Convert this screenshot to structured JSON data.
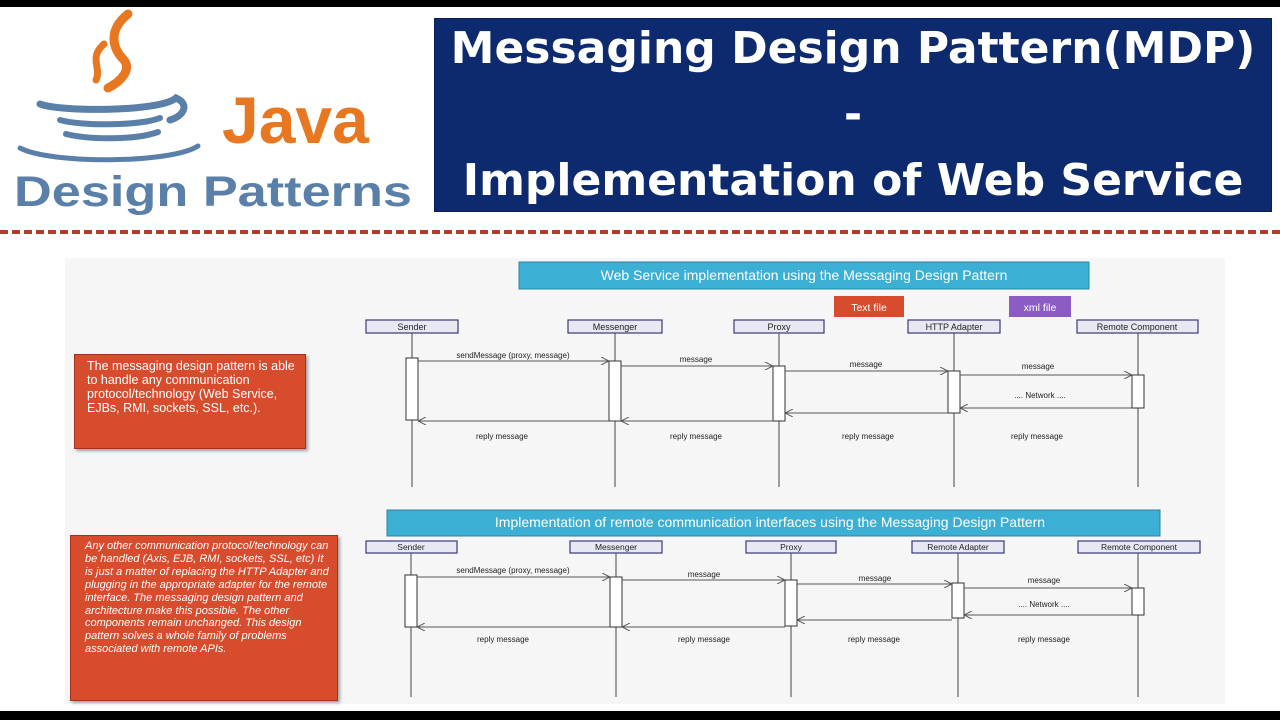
{
  "logo": {
    "java": "Java",
    "design_patterns": "Design Patterns"
  },
  "title": {
    "line1": "Messaging Design Pattern(MDP) -",
    "line2": "Implementation of Web Service"
  },
  "diagram1": {
    "heading": "Web Service implementation using the Messaging Design Pattern",
    "tag_text_file": "Text file",
    "tag_xml_file": "xml file",
    "lifelines": [
      "Sender",
      "Messenger",
      "Proxy",
      "HTTP Adapter",
      "Remote Component"
    ],
    "call_labels": [
      "sendMessage (proxy, message)",
      "message",
      "message",
      "message"
    ],
    "network_label": ".... Network ....",
    "reply_labels": [
      "reply message",
      "reply message",
      "reply message",
      "reply message"
    ]
  },
  "diagram2": {
    "heading": "Implementation of remote communication interfaces using the Messaging Design Pattern",
    "lifelines": [
      "Sender",
      "Messenger",
      "Proxy",
      "Remote Adapter",
      "Remote Component"
    ],
    "call_labels": [
      "sendMessage (proxy, message)",
      "message",
      "message",
      "message"
    ],
    "network_label": ".... Network ....",
    "reply_labels": [
      "reply message",
      "reply message",
      "reply message",
      "reply message"
    ]
  },
  "note1": "The messaging design pattern is able to handle any communication protocol/technology (Web Service, EJBs, RMI, sockets, SSL, etc.).",
  "note2": "Any other communication protocol/technology can be handled (Axis, EJB, RMI, sockets, SSL, etc) It is just a matter of replacing the HTTP Adapter and plugging in the appropriate adapter for the remote interface. The messaging design pattern and architecture make this possible. The other components remain unchanged. This design pattern solves a whole family of problems associated with remote APIs.",
  "colors": {
    "title_bg": "#0d2a6e",
    "note_bg": "#d84c2e",
    "heading_bg": "#3bb0d4",
    "dash": "#b23a2e",
    "java_orange": "#e87722",
    "java_blue": "#5a7fa8"
  }
}
